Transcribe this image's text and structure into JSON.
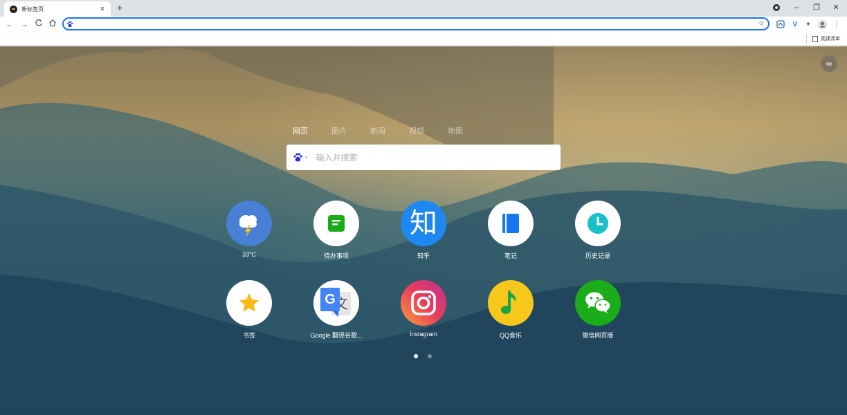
{
  "browser": {
    "tab_title": "新标签页",
    "tab_close": "×",
    "new_tab": "+",
    "window": {
      "profile": "●",
      "minimize": "–",
      "restore": "❐",
      "close": "✕"
    },
    "nav": {
      "back": "←",
      "forward": "→",
      "reload": "C",
      "home": "⌂"
    },
    "address": {
      "value": "",
      "star": "☆"
    },
    "extensions": {
      "v_ext": "V",
      "puzzle": "✦",
      "menu": "⋮"
    },
    "reading_list": "阅读清单"
  },
  "page": {
    "corner_button": "∞",
    "search_tabs": [
      {
        "label": "网页",
        "active": true
      },
      {
        "label": "图片",
        "active": false
      },
      {
        "label": "新闻",
        "active": false
      },
      {
        "label": "视频",
        "active": false
      },
      {
        "label": "地图",
        "active": false
      }
    ],
    "search": {
      "placeholder": "输入并搜索",
      "engine_caret": "▾"
    },
    "tiles": [
      {
        "label": "33°C",
        "icon": "weather-icon",
        "bg": "#4a7fd6"
      },
      {
        "label": "待办事项",
        "icon": "todo-icon",
        "bg": "#ffffff"
      },
      {
        "label": "知乎",
        "icon": "zhihu-icon",
        "bg": "#1e88f0",
        "glyph": "知"
      },
      {
        "label": "笔记",
        "icon": "notes-icon",
        "bg": "#ffffff"
      },
      {
        "label": "历史记录",
        "icon": "history-icon",
        "bg": "#ffffff"
      },
      {
        "label": "书签",
        "icon": "bookmark-star-icon",
        "bg": "#ffffff"
      },
      {
        "label": "Google 翻译谷歌...",
        "icon": "google-translate-icon",
        "bg": "#ffffff",
        "glyph_g": "G",
        "glyph_wen": "文"
      },
      {
        "label": "Instagram",
        "icon": "instagram-icon",
        "bg": "#e1306c"
      },
      {
        "label": "QQ音乐",
        "icon": "qq-music-icon",
        "bg": "#f7c81b"
      },
      {
        "label": "微信网页版",
        "icon": "wechat-icon",
        "bg": "#1aad19"
      }
    ],
    "pagination": {
      "pages": 2,
      "current": 1
    }
  }
}
